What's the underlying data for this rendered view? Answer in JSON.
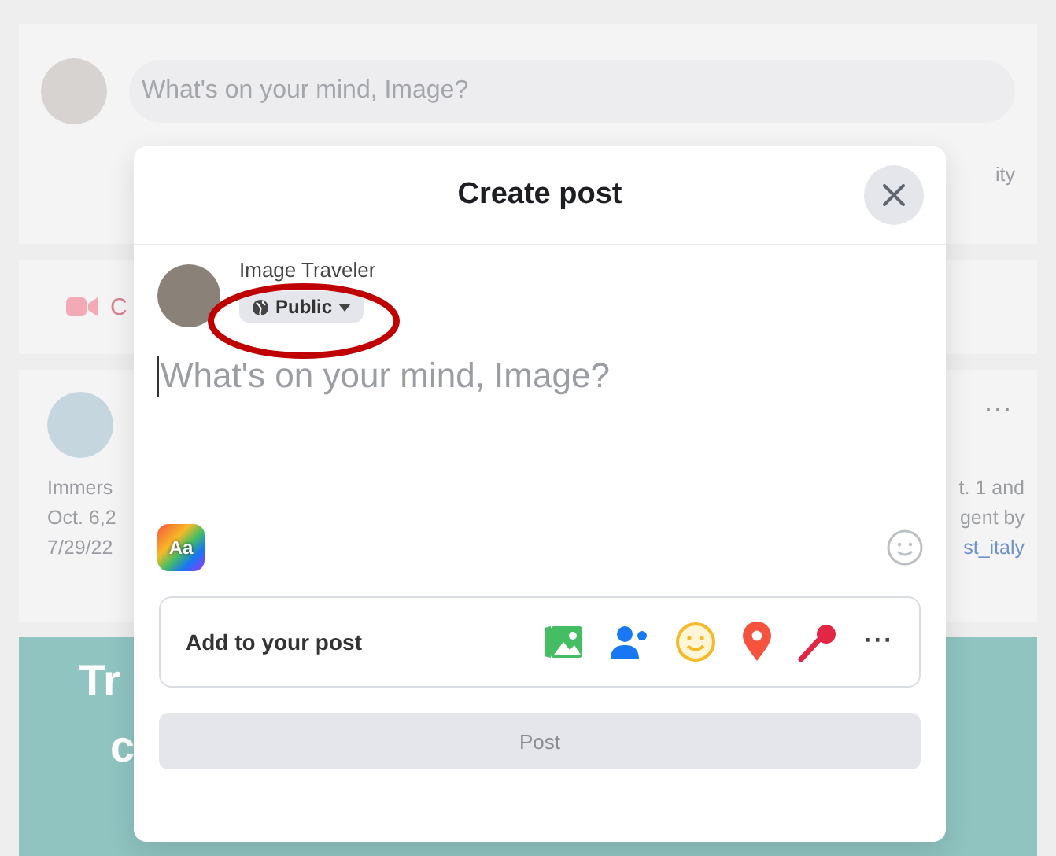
{
  "background": {
    "composer": {
      "placeholder": "What's on your mind, Image?",
      "action_fragment": "ity"
    },
    "room_fragment": "C",
    "post": {
      "more": "···",
      "lines_left": [
        "Immers",
        "Oct. 6,2",
        "7/29/22"
      ],
      "lines_right": [
        "t. 1 and",
        "gent by",
        "st_italy"
      ]
    },
    "banner": {
      "lines": [
        "Tr",
        "c"
      ]
    }
  },
  "dialog": {
    "title": "Create post",
    "user": {
      "name": "Image Traveler",
      "audience": "Public"
    },
    "composer": {
      "placeholder": "What's on your mind, Image?"
    },
    "text_style": {
      "label": "Aa"
    },
    "add_to_post": {
      "label": "Add to your post",
      "more": "···"
    },
    "post_button": {
      "label": "Post",
      "disabled": true
    }
  }
}
